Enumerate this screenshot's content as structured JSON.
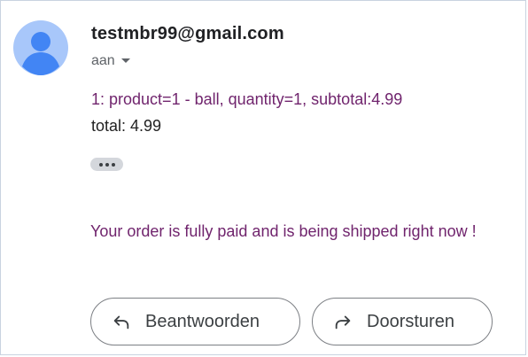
{
  "email": {
    "sender": "testmbr99@gmail.com",
    "recipient_label": "aan",
    "body": {
      "line1": "1: product=1 - ball, quantity=1, subtotal:4.99",
      "line2": "total: 4.99",
      "message": "Your order is fully paid and is being shipped right now !"
    }
  },
  "actions": {
    "reply_label": "Beantwoorden",
    "forward_label": "Doorsturen"
  },
  "icons": [
    "avatar-person-icon",
    "chevron-down-icon",
    "more-dots-icon",
    "reply-arrow-icon",
    "forward-arrow-icon"
  ],
  "colors": {
    "avatar_bg": "#a8c7fa",
    "avatar_fg": "#4285f4",
    "body_purple": "#70246d",
    "text_dark": "#202124",
    "muted": "#5f6368"
  }
}
